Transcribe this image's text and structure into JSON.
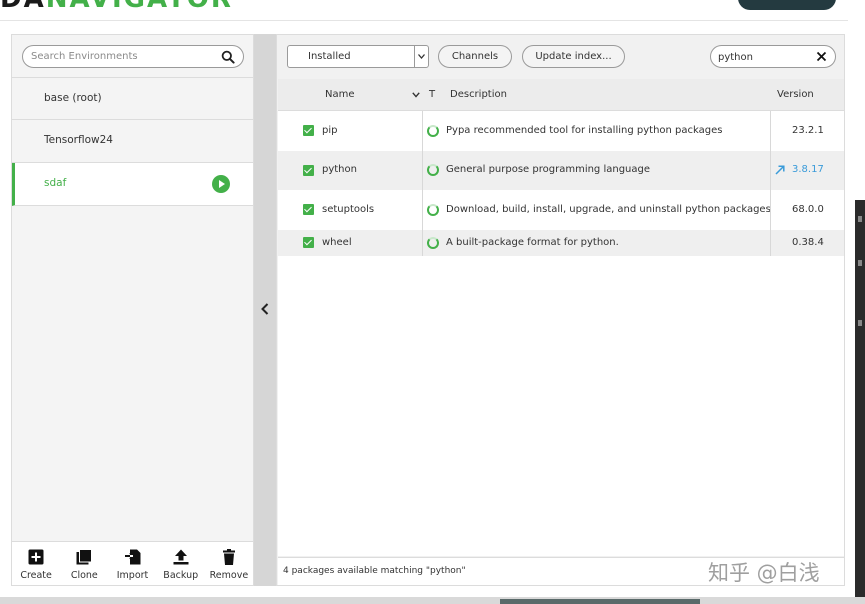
{
  "app": {
    "logo_text_dark": "DA",
    "logo_text_accent": "NAVIGATOR"
  },
  "environments": {
    "search": {
      "placeholder": "Search Environments",
      "icon": "search-icon"
    },
    "items": [
      {
        "label": "base (root)",
        "active": false
      },
      {
        "label": "Tensorflow24",
        "active": false
      },
      {
        "label": "sdaf",
        "active": true,
        "icon": "play-icon"
      }
    ],
    "actions": [
      {
        "label": "Create",
        "icon": "plus-square-icon"
      },
      {
        "label": "Clone",
        "icon": "copy-icon"
      },
      {
        "label": "Import",
        "icon": "import-icon"
      },
      {
        "label": "Backup",
        "icon": "upload-icon"
      },
      {
        "label": "Remove",
        "icon": "trash-icon"
      }
    ]
  },
  "packages": {
    "filter": {
      "selected": "Installed"
    },
    "buttons": {
      "channels": "Channels",
      "update_index": "Update index..."
    },
    "search": {
      "value": "python",
      "clear_icon": "close-icon"
    },
    "columns": {
      "name": "Name",
      "type": "T",
      "description": "Description",
      "version": "Version"
    },
    "rows": [
      {
        "name": "pip",
        "checked": true,
        "description": "Pypa recommended tool for installing python packages",
        "version": "23.2.1",
        "upgradable": false
      },
      {
        "name": "python",
        "checked": true,
        "description": "General purpose programming language",
        "version": "3.8.17",
        "upgradable": true
      },
      {
        "name": "setuptools",
        "checked": true,
        "description": "Download, build, install, upgrade, and uninstall python packages",
        "version": "68.0.0",
        "upgradable": false
      },
      {
        "name": "wheel",
        "checked": true,
        "description": "A built-package format for python.",
        "version": "0.38.4",
        "upgradable": false
      }
    ],
    "footer": "4 packages available matching \"python\""
  },
  "watermark": "知乎 @白浅",
  "colors": {
    "accent_green": "#43b049",
    "upgrade_blue": "#3a9bd9"
  }
}
